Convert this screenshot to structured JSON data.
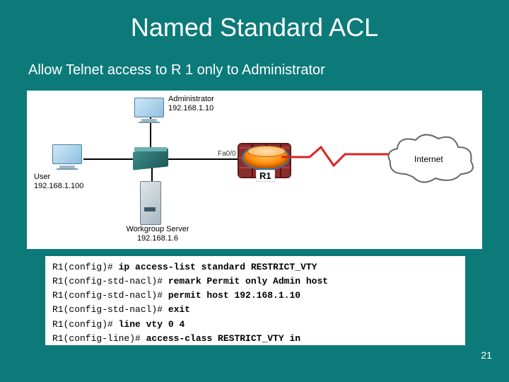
{
  "title": "Named Standard ACL",
  "subtitle": "Allow Telnet access to R 1 only to Administrator",
  "page_number": "21",
  "diagram": {
    "admin": {
      "name": "Administrator",
      "ip": "192.168.1.10"
    },
    "user": {
      "name": "User",
      "ip": "192.168.1.100"
    },
    "server": {
      "name": "Workgroup Server",
      "ip": "192.168.1.6"
    },
    "router": {
      "name": "R1",
      "iface": "Fa0/0"
    },
    "cloud": {
      "label": "Internet"
    }
  },
  "cli": [
    {
      "prompt": "R1(config)# ",
      "cmd": "ip access-list standard RESTRICT_VTY"
    },
    {
      "prompt": "R1(config-std-nacl)# ",
      "cmd": "remark Permit only Admin host"
    },
    {
      "prompt": "R1(config-std-nacl)# ",
      "cmd": "permit host 192.168.1.10"
    },
    {
      "prompt": "R1(config-std-nacl)# ",
      "cmd": "exit"
    },
    {
      "prompt": "R1(config)# ",
      "cmd": "line vty 0 4"
    },
    {
      "prompt": "R1(config-line)# ",
      "cmd": "access-class RESTRICT_VTY in"
    }
  ]
}
